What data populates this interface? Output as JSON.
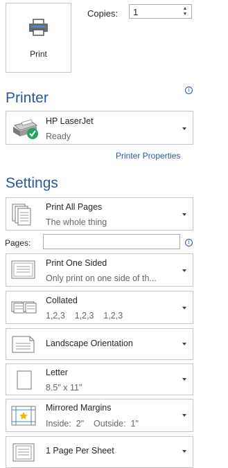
{
  "print_button": {
    "label": "Print"
  },
  "copies": {
    "label": "Copies:",
    "value": "1"
  },
  "printer": {
    "section_title": "Printer",
    "name": "HP LaserJet",
    "status": "Ready",
    "properties_link": "Printer Properties"
  },
  "settings": {
    "section_title": "Settings",
    "pages_label": "Pages:",
    "pages_value": "",
    "options": [
      {
        "title": "Print All Pages",
        "subtitle": "The whole thing"
      },
      {
        "title": "Print One Sided",
        "subtitle": "Only print on one side of th..."
      },
      {
        "title": "Collated",
        "subtitle": "1,2,3    1,2,3    1,2,3"
      },
      {
        "title": "Landscape Orientation",
        "subtitle": ""
      },
      {
        "title": "Letter",
        "subtitle": "8.5\" x 11\""
      },
      {
        "title": "Mirrored Margins",
        "subtitle": "Inside:  2\"    Outside:  1\""
      },
      {
        "title": "1 Page Per Sheet",
        "subtitle": ""
      }
    ]
  },
  "colors": {
    "accent": "#2b579a",
    "status_green": "#21a366",
    "border": "#c6c6c6"
  }
}
